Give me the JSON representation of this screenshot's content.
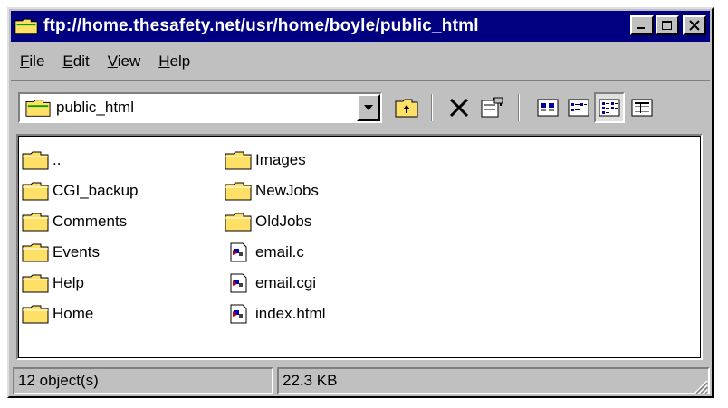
{
  "window": {
    "title": "ftp://home.thesafety.net/usr/home/boyle/public_html",
    "title_icon": "folder-icon",
    "minimize_icon": "minimize-icon",
    "maximize_icon": "maximize-icon",
    "close_icon": "close-icon",
    "colors": {
      "titlebar": "#000080",
      "face": "#c0c0c0",
      "folder": "#ffe066"
    }
  },
  "menu": {
    "items": [
      {
        "label": "File",
        "accel": "F",
        "rest": "ile"
      },
      {
        "label": "Edit",
        "accel": "E",
        "rest": "dit"
      },
      {
        "label": "View",
        "accel": "V",
        "rest": "iew"
      },
      {
        "label": "Help",
        "accel": "H",
        "rest": "elp"
      }
    ]
  },
  "toolbar": {
    "address_value": "public_html",
    "buttons": [
      {
        "name": "up-one-level",
        "icon": "up-folder-icon"
      },
      {
        "name": "delete",
        "icon": "delete-x-icon"
      },
      {
        "name": "properties",
        "icon": "properties-icon"
      },
      {
        "name": "large-icons",
        "icon": "large-icons-view-icon"
      },
      {
        "name": "small-icons",
        "icon": "small-icons-view-icon"
      },
      {
        "name": "list",
        "icon": "list-view-icon",
        "pressed": true
      },
      {
        "name": "details",
        "icon": "details-view-icon"
      }
    ]
  },
  "files": {
    "column1": [
      {
        "name": "..",
        "icon": "folder-icon"
      },
      {
        "name": "CGI_backup",
        "icon": "folder-icon"
      },
      {
        "name": "Comments",
        "icon": "folder-icon"
      },
      {
        "name": "Events",
        "icon": "folder-icon"
      },
      {
        "name": "Help",
        "icon": "folder-icon"
      },
      {
        "name": "Home",
        "icon": "folder-icon"
      }
    ],
    "column2": [
      {
        "name": "Images",
        "icon": "folder-icon"
      },
      {
        "name": "NewJobs",
        "icon": "folder-icon"
      },
      {
        "name": "OldJobs",
        "icon": "folder-icon"
      },
      {
        "name": "email.c",
        "icon": "file-icon"
      },
      {
        "name": "email.cgi",
        "icon": "file-icon"
      },
      {
        "name": "index.html",
        "icon": "file-icon"
      }
    ]
  },
  "status": {
    "objects": "12 object(s)",
    "size": "22.3 KB"
  }
}
